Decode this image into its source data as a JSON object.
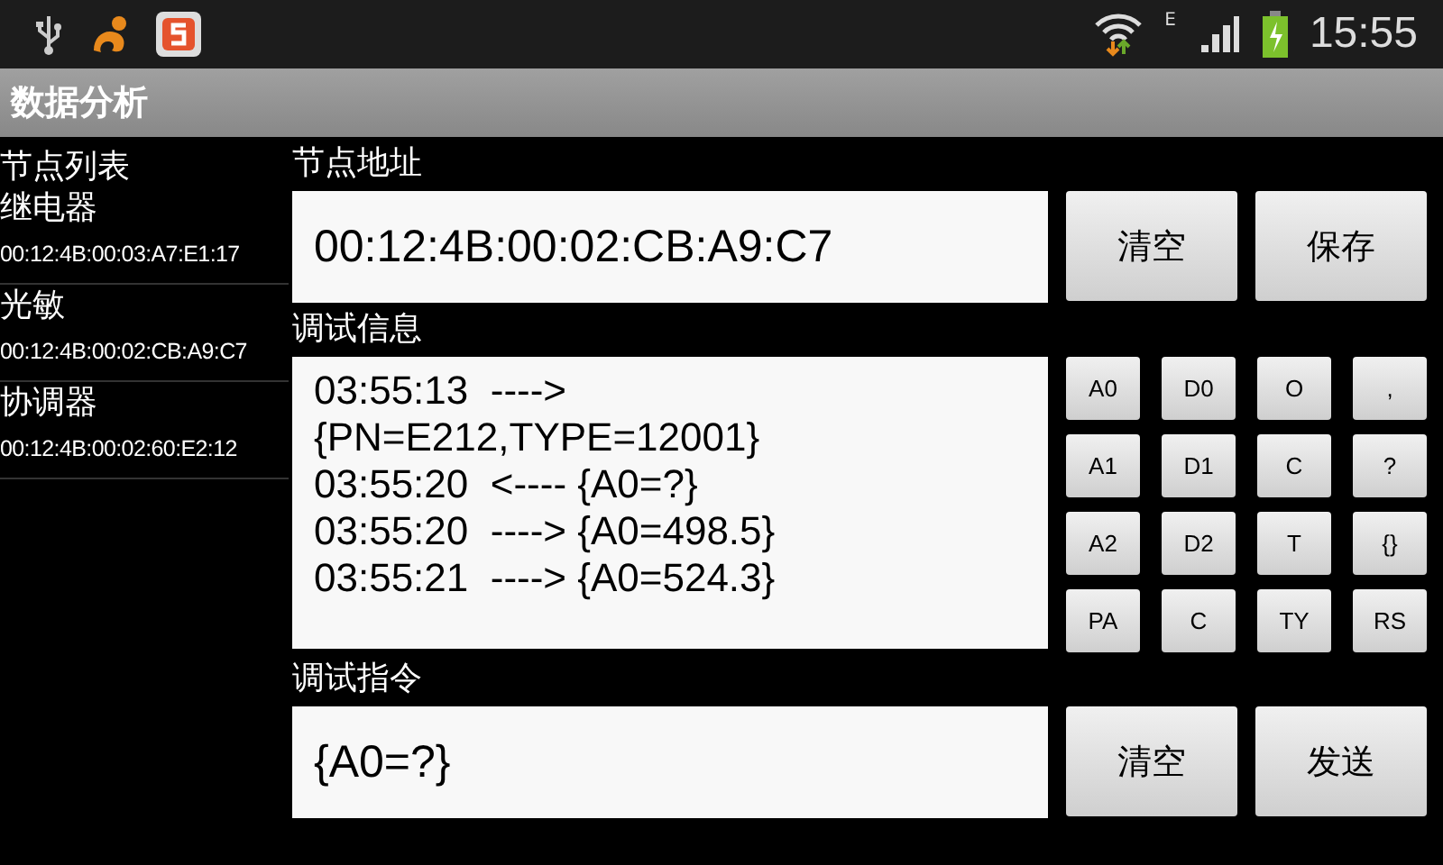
{
  "status_bar": {
    "network_type": "E",
    "time": "15:55"
  },
  "title_bar": {
    "title": "数据分析"
  },
  "node_list": {
    "title": "节点列表",
    "items": [
      {
        "name": "继电器",
        "address": "00:12:4B:00:03:A7:E1:17"
      },
      {
        "name": "光敏",
        "address": "00:12:4B:00:02:CB:A9:C7"
      },
      {
        "name": "协调器",
        "address": "00:12:4B:00:02:60:E2:12"
      }
    ]
  },
  "node_address": {
    "label": "节点地址",
    "value": "00:12:4B:00:02:CB:A9:C7",
    "buttons": [
      "清空",
      "保存"
    ]
  },
  "debug_info": {
    "label": "调试信息",
    "lines": [
      "03:55:13  ---->",
      "{PN=E212,TYPE=12001}",
      "03:55:20  <---- {A0=?}",
      "03:55:20  ----> {A0=498.5}",
      "03:55:21  ----> {A0=524.3}"
    ],
    "keys": [
      "A0",
      "D0",
      "O",
      ",",
      "A1",
      "D1",
      "C",
      "?",
      "A2",
      "D2",
      "T",
      "{}",
      "PA",
      "C",
      "TY",
      "RS"
    ]
  },
  "debug_command": {
    "label": "调试指令",
    "value": "{A0=?}",
    "buttons": [
      "清空",
      "发送"
    ]
  }
}
